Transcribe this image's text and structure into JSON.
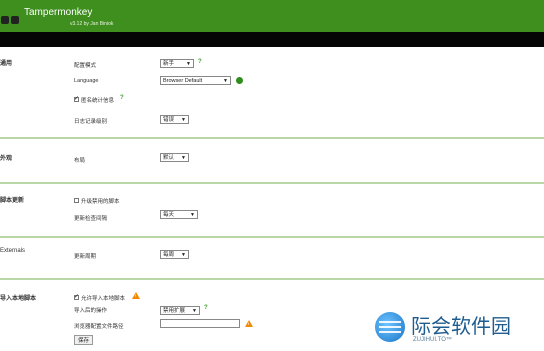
{
  "app": {
    "title": "Tampermonkey",
    "version": "v3.12 by Jan Biniok"
  },
  "sections": {
    "general": {
      "title": "通用",
      "config_mode_label": "配置模式",
      "config_mode_value": "新手",
      "language_label": "Language",
      "language_value": "Browser Default",
      "stats_label": "匿名统计信息",
      "log_level_label": "日志记录级别",
      "log_level_value": "错误"
    },
    "appearance": {
      "title": "外观",
      "layout_label": "布局",
      "layout_value": "默认"
    },
    "script_update": {
      "title": "脚本更新",
      "check_disabled_label": "升级禁用的脚本",
      "interval_label": "更新检查间隔",
      "interval_value": "每天"
    },
    "externals": {
      "title": "Externals",
      "update_period_label": "更新周期",
      "update_period_value": "每周"
    },
    "import_local": {
      "title": "导入本地脚本",
      "allow_label": "允许导入本地脚本",
      "after_import_label": "导入后的操作",
      "after_import_value": "禁用扩展",
      "browser_path_label": "浏览器配置文件路径",
      "save_label": "保存"
    }
  },
  "watermark": {
    "main": "际会软件园",
    "sub": "ZUJIHUI.TO™"
  },
  "colors": {
    "header_green": "#3f8f1f",
    "accent_green": "#3c9a2a",
    "warn_orange": "#f08a00",
    "separator": "#b8d7a5"
  },
  "icons": [
    "help-icon",
    "globe-icon",
    "warning-icon",
    "checkbox-icon",
    "dropdown-arrow-icon"
  ]
}
